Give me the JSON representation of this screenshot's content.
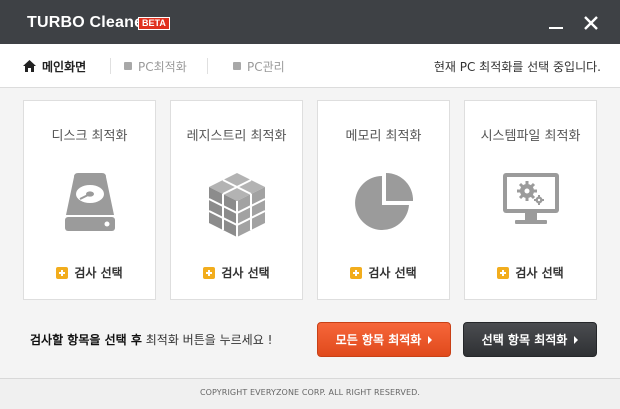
{
  "window": {
    "title": "TURBO Cleaner",
    "badge": "BETA"
  },
  "nav": {
    "home": "메인화면",
    "pc_optimize": "PC최적화",
    "pc_manage": "PC관리",
    "status": "현재 PC 최적화를 선택 중입니다."
  },
  "cards": [
    {
      "title": "디스크 최적화",
      "icon": "hard-disk-icon",
      "select": "검사 선택"
    },
    {
      "title": "레지스트리 최적화",
      "icon": "registry-cubes-icon",
      "select": "검사 선택"
    },
    {
      "title": "메모리 최적화",
      "icon": "memory-pie-icon",
      "select": "검사 선택"
    },
    {
      "title": "시스템파일 최적화",
      "icon": "system-monitor-icon",
      "select": "검사 선택"
    }
  ],
  "instruction": {
    "part1": "검사할 항목을 선택 후",
    "part2": "최적화 버튼을 누르세요 !"
  },
  "buttons": {
    "optimize_all": "모든 항목 최적화",
    "optimize_selected": "선택 항목 최적화"
  },
  "footer": {
    "copyright": "COPYRIGHT EVERYZONE CORP. ALL RIGHT RESERVED."
  },
  "colors": {
    "titlebar": "#3e4145",
    "accent_orange": "#f05a2a",
    "dark_button": "#3a3c40",
    "plus_icon": "#f2ad1d",
    "icon_gray": "#9b9b9b"
  }
}
